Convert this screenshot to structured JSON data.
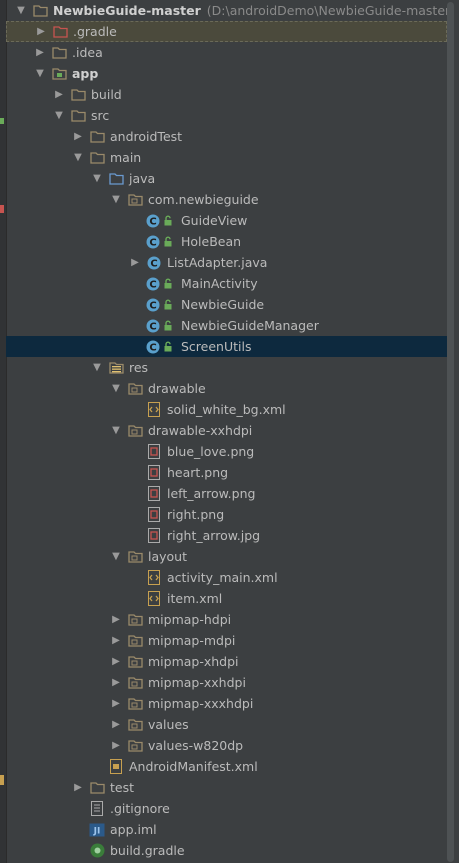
{
  "colors": {
    "folder": "#9a8a6a",
    "folder_red": "#c75450",
    "folder_blue": "#6a9ad0",
    "class_icon": "#5aa0cc",
    "lock": "#6aab59",
    "selection": "#0d293e",
    "highlight": "#4b4a3c"
  },
  "tree": [
    {
      "depth": 0,
      "arrow": "down",
      "icon": "folder-icon",
      "label": "NewbieGuide-master",
      "bold": true,
      "path": "(D:\\androidDemo\\NewbieGuide-master)"
    },
    {
      "depth": 1,
      "arrow": "right",
      "icon": "folder-red-icon",
      "label": ".gradle",
      "highlight": true
    },
    {
      "depth": 1,
      "arrow": "right",
      "icon": "folder-icon",
      "label": ".idea"
    },
    {
      "depth": 1,
      "arrow": "down",
      "icon": "module-folder-icon",
      "label": "app",
      "bold": true
    },
    {
      "depth": 2,
      "arrow": "right",
      "icon": "folder-icon",
      "label": "build"
    },
    {
      "depth": 2,
      "arrow": "down",
      "icon": "folder-icon",
      "label": "src"
    },
    {
      "depth": 3,
      "arrow": "right",
      "icon": "folder-icon",
      "label": "androidTest"
    },
    {
      "depth": 3,
      "arrow": "down",
      "icon": "folder-icon",
      "label": "main"
    },
    {
      "depth": 4,
      "arrow": "down",
      "icon": "source-folder-icon",
      "label": "java"
    },
    {
      "depth": 5,
      "arrow": "down",
      "icon": "package-icon",
      "label": "com.newbieguide"
    },
    {
      "depth": 6,
      "arrow": "none",
      "icon": "class-icon",
      "label": "GuideView",
      "lock": true
    },
    {
      "depth": 6,
      "arrow": "none",
      "icon": "class-icon",
      "label": "HoleBean",
      "lock": true
    },
    {
      "depth": 6,
      "arrow": "right",
      "icon": "class-icon",
      "label": "ListAdapter.java"
    },
    {
      "depth": 6,
      "arrow": "none",
      "icon": "class-icon",
      "label": "MainActivity",
      "lock": true
    },
    {
      "depth": 6,
      "arrow": "none",
      "icon": "class-icon",
      "label": "NewbieGuide",
      "lock": true
    },
    {
      "depth": 6,
      "arrow": "none",
      "icon": "class-icon",
      "label": "NewbieGuideManager",
      "lock": true
    },
    {
      "depth": 6,
      "arrow": "none",
      "icon": "class-icon",
      "label": "ScreenUtils",
      "lock": true,
      "selected": true
    },
    {
      "depth": 4,
      "arrow": "down",
      "icon": "resource-folder-icon",
      "label": "res"
    },
    {
      "depth": 5,
      "arrow": "down",
      "icon": "package-icon",
      "label": "drawable"
    },
    {
      "depth": 6,
      "arrow": "none",
      "icon": "xml-file-icon",
      "label": "solid_white_bg.xml"
    },
    {
      "depth": 5,
      "arrow": "down",
      "icon": "package-icon",
      "label": "drawable-xxhdpi"
    },
    {
      "depth": 6,
      "arrow": "none",
      "icon": "image-file-icon",
      "label": "blue_love.png"
    },
    {
      "depth": 6,
      "arrow": "none",
      "icon": "image-file-icon",
      "label": "heart.png"
    },
    {
      "depth": 6,
      "arrow": "none",
      "icon": "image-file-icon",
      "label": "left_arrow.png"
    },
    {
      "depth": 6,
      "arrow": "none",
      "icon": "image-file-icon",
      "label": "right.png"
    },
    {
      "depth": 6,
      "arrow": "none",
      "icon": "image-file-icon",
      "label": "right_arrow.jpg"
    },
    {
      "depth": 5,
      "arrow": "down",
      "icon": "package-icon",
      "label": "layout"
    },
    {
      "depth": 6,
      "arrow": "none",
      "icon": "xml-file-icon",
      "label": "activity_main.xml"
    },
    {
      "depth": 6,
      "arrow": "none",
      "icon": "xml-file-icon",
      "label": "item.xml"
    },
    {
      "depth": 5,
      "arrow": "right",
      "icon": "package-icon",
      "label": "mipmap-hdpi"
    },
    {
      "depth": 5,
      "arrow": "right",
      "icon": "package-icon",
      "label": "mipmap-mdpi"
    },
    {
      "depth": 5,
      "arrow": "right",
      "icon": "package-icon",
      "label": "mipmap-xhdpi"
    },
    {
      "depth": 5,
      "arrow": "right",
      "icon": "package-icon",
      "label": "mipmap-xxhdpi"
    },
    {
      "depth": 5,
      "arrow": "right",
      "icon": "package-icon",
      "label": "mipmap-xxxhdpi"
    },
    {
      "depth": 5,
      "arrow": "right",
      "icon": "package-icon",
      "label": "values"
    },
    {
      "depth": 5,
      "arrow": "right",
      "icon": "package-icon",
      "label": "values-w820dp"
    },
    {
      "depth": 4,
      "arrow": "none",
      "icon": "manifest-file-icon",
      "label": "AndroidManifest.xml"
    },
    {
      "depth": 3,
      "arrow": "right",
      "icon": "folder-icon",
      "label": "test"
    },
    {
      "depth": 3,
      "arrow": "none",
      "icon": "text-file-icon",
      "label": ".gitignore"
    },
    {
      "depth": 3,
      "arrow": "none",
      "icon": "iml-file-icon",
      "label": "app.iml"
    },
    {
      "depth": 3,
      "arrow": "none",
      "icon": "gradle-file-icon",
      "label": "build.gradle"
    }
  ]
}
